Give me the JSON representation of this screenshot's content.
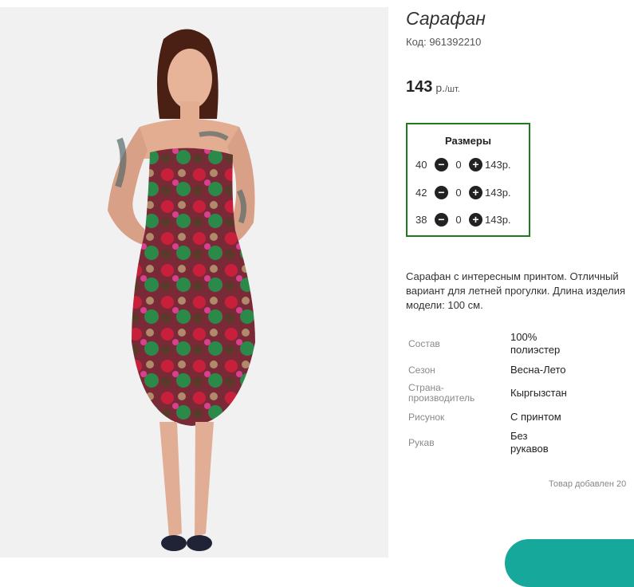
{
  "product": {
    "title": "Сарафан",
    "code": "Код: 961392210",
    "price": {
      "amount": "143",
      "unit": "р.",
      "per": "/шт."
    }
  },
  "sizes": {
    "title": "Размеры",
    "rows": [
      {
        "size": "40",
        "qty": "0",
        "price": "143р."
      },
      {
        "size": "42",
        "qty": "0",
        "price": "143р."
      },
      {
        "size": "38",
        "qty": "0",
        "price": "143р."
      }
    ]
  },
  "description": "Сарафан с интересным принтом. Отличный вариант для летней прогулки. Длина изделия модели: 100 см.",
  "properties": [
    {
      "key": "Состав",
      "value": "100% полиэстер"
    },
    {
      "key": "Сезон",
      "value": "Весна-Лето"
    },
    {
      "key": "Страна-производитель",
      "value": "Кыргызстан"
    },
    {
      "key": "Рисунок",
      "value": "С принтом"
    },
    {
      "key": "Рукав",
      "value": "Без рукавов"
    }
  ],
  "added_text": "Товар добавлен 20",
  "colors": {
    "size_box_border": "#1e7a1e",
    "accent_button": "#16a89a"
  },
  "icons": {
    "minus": "minus-circle-icon",
    "plus": "plus-circle-icon"
  }
}
